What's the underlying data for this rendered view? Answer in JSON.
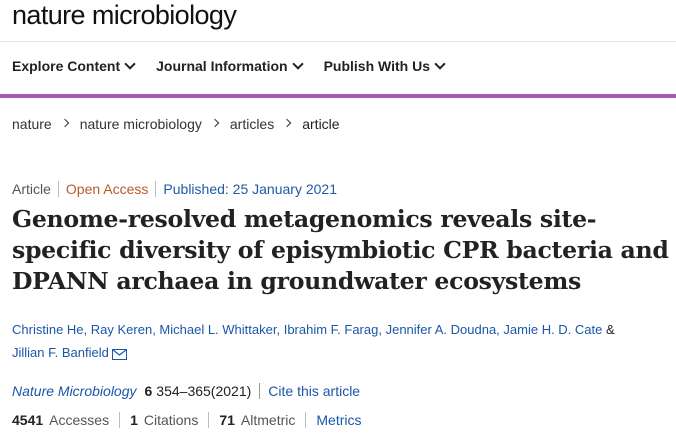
{
  "site": {
    "logo": "nature microbiology"
  },
  "nav": {
    "items": [
      "Explore Content",
      "Journal Information",
      "Publish With Us"
    ]
  },
  "breadcrumb": [
    "nature",
    "nature microbiology",
    "articles",
    "article"
  ],
  "meta": {
    "type": "Article",
    "access": "Open Access",
    "published": "Published: 25 January 2021"
  },
  "article": {
    "title": "Genome-resolved metagenomics reveals site-specific diversity of episymbiotic CPR bacteria and DPANN archaea in groundwater ecosystems"
  },
  "authors": {
    "list": [
      "Christine He",
      "Ray Keren",
      "Michael L. Whittaker",
      "Ibrahim F. Farag",
      "Jennifer A. Doudna",
      "Jamie H. D. Cate",
      "Jillian F. Banfield"
    ],
    "amp": "&"
  },
  "citation": {
    "journal": "Nature Microbiology",
    "volume": "6",
    "pages": "354–365(2021)",
    "cite_label": "Cite this article"
  },
  "metrics": {
    "accesses": "4541",
    "accesses_label": "Accesses",
    "citations": "1",
    "citations_label": "Citations",
    "altmetric": "71",
    "altmetric_label": "Altmetric",
    "metrics_label": "Metrics"
  },
  "colors": {
    "accent_bar": "#a35cbd",
    "link": "#1a57a8",
    "open_access": "#b85a2c"
  }
}
